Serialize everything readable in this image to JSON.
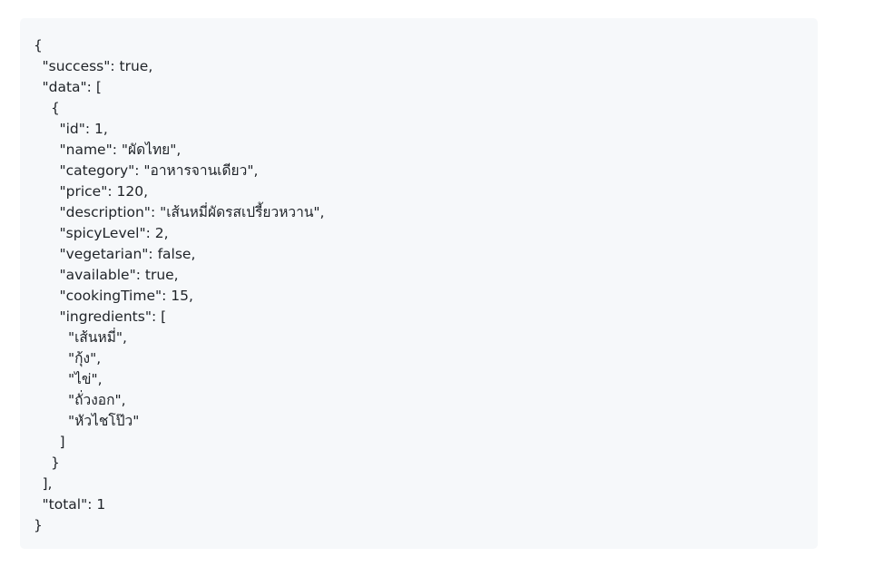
{
  "response": {
    "lines": [
      {
        "indent": 0,
        "text": "{"
      },
      {
        "indent": 1,
        "text": "\"success\": true,"
      },
      {
        "indent": 1,
        "text": "\"data\": ["
      },
      {
        "indent": 2,
        "text": "{"
      },
      {
        "indent": 3,
        "text": "\"id\": 1,"
      },
      {
        "indent": 3,
        "text": "\"name\": \"ผัดไทย\","
      },
      {
        "indent": 3,
        "text": "\"category\": \"อาหารจานเดียว\","
      },
      {
        "indent": 3,
        "text": "\"price\": 120,"
      },
      {
        "indent": 3,
        "text": "\"description\": \"เส้นหมี่ผัดรสเปรี้ยวหวาน\","
      },
      {
        "indent": 3,
        "text": "\"spicyLevel\": 2,"
      },
      {
        "indent": 3,
        "text": "\"vegetarian\": false,"
      },
      {
        "indent": 3,
        "text": "\"available\": true,"
      },
      {
        "indent": 3,
        "text": "\"cookingTime\": 15,"
      },
      {
        "indent": 3,
        "text": "\"ingredients\": ["
      },
      {
        "indent": 4,
        "text": "\"เส้นหมี่\","
      },
      {
        "indent": 4,
        "text": "\"กุ้ง\","
      },
      {
        "indent": 4,
        "text": "\"ไข่\","
      },
      {
        "indent": 4,
        "text": "\"ถั่วงอก\","
      },
      {
        "indent": 4,
        "text": "\"หัวไชโป๊ว\""
      },
      {
        "indent": 3,
        "text": "]"
      },
      {
        "indent": 2,
        "text": "}"
      },
      {
        "indent": 1,
        "text": "],"
      },
      {
        "indent": 1,
        "text": "\"total\": 1"
      },
      {
        "indent": 0,
        "text": "}"
      }
    ]
  }
}
